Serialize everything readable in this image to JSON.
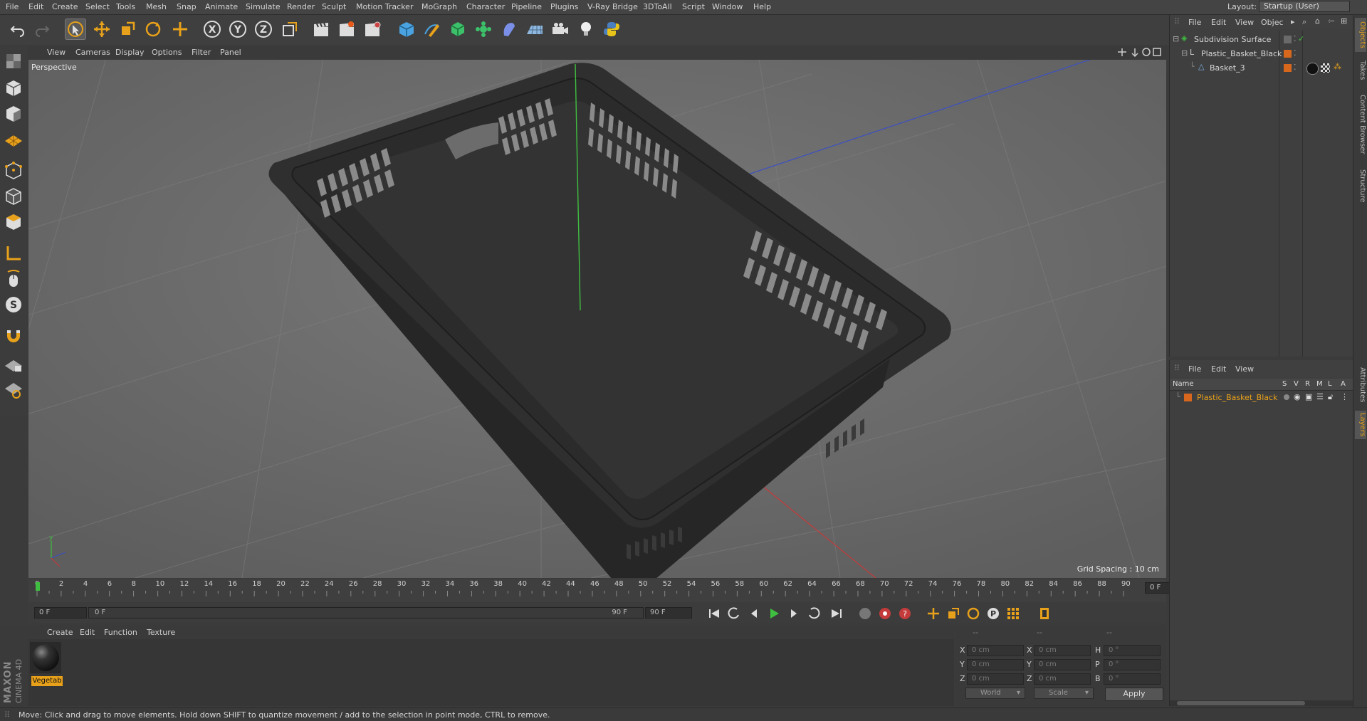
{
  "menubar": {
    "items": [
      "File",
      "Edit",
      "Create",
      "Select",
      "Tools",
      "Mesh",
      "Snap",
      "Animate",
      "Simulate",
      "Render",
      "Sculpt",
      "Motion Tracker",
      "MoGraph",
      "Character",
      "Pipeline",
      "Plugins",
      "V-Ray Bridge",
      "3DToAll",
      "Script",
      "Window",
      "Help"
    ],
    "layout_label": "Layout:",
    "layout_value": "Startup (User)"
  },
  "viewport": {
    "menu": [
      "View",
      "Cameras",
      "Display",
      "Options",
      "Filter",
      "Panel"
    ],
    "camera_label": "Perspective",
    "grid_spacing": "Grid Spacing : 10 cm"
  },
  "timeline": {
    "ticks": [
      "0",
      "2",
      "4",
      "6",
      "8",
      "10",
      "12",
      "14",
      "16",
      "18",
      "20",
      "22",
      "24",
      "26",
      "28",
      "30",
      "32",
      "34",
      "36",
      "38",
      "40",
      "42",
      "44",
      "46",
      "48",
      "50",
      "52",
      "54",
      "56",
      "58",
      "60",
      "62",
      "64",
      "66",
      "68",
      "70",
      "72",
      "74",
      "76",
      "78",
      "80",
      "82",
      "84",
      "86",
      "88",
      "90"
    ],
    "current_frame": "0 F",
    "start_field": "0 F",
    "range_start": "0 F",
    "range_end": "90 F",
    "end_field": "90 F"
  },
  "material_manager": {
    "menu": [
      "Create",
      "Edit",
      "Function",
      "Texture"
    ],
    "materials": [
      {
        "name": "Vegetab"
      }
    ]
  },
  "coordinates": {
    "header": [
      "--",
      "--",
      "--"
    ],
    "rows": [
      {
        "l1": "X",
        "v1": "0 cm",
        "l2": "X",
        "v2": "0 cm",
        "l3": "H",
        "v3": "0 °"
      },
      {
        "l1": "Y",
        "v1": "0 cm",
        "l2": "Y",
        "v2": "0 cm",
        "l3": "P",
        "v3": "0 °"
      },
      {
        "l1": "Z",
        "v1": "0 cm",
        "l2": "Z",
        "v2": "0 cm",
        "l3": "B",
        "v3": "0 °"
      }
    ],
    "space_select": "World",
    "mode_select": "Scale",
    "apply_label": "Apply"
  },
  "object_manager": {
    "menu": [
      "File",
      "Edit",
      "View",
      "Objec"
    ],
    "objects": [
      {
        "name": "Subdivision Surface",
        "indent": 0
      },
      {
        "name": "Plastic_Basket_Black",
        "indent": 1
      },
      {
        "name": "Basket_3",
        "indent": 2
      }
    ]
  },
  "layer_manager": {
    "menu": [
      "File",
      "Edit",
      "View"
    ],
    "columns": [
      "Name",
      "S",
      "V",
      "R",
      "M",
      "L",
      "A"
    ],
    "layers": [
      {
        "name": "Plastic_Basket_Black",
        "color": "#d8671e"
      }
    ]
  },
  "side_tabs": [
    "Objects",
    "Takes",
    "Content Browser",
    "Structure",
    "Attributes",
    "Layers"
  ],
  "status": {
    "text": "Move: Click and drag to move elements. Hold down SHIFT to quantize movement / add to the selection in point mode, CTRL to remove."
  },
  "logo": {
    "line1": "MAXON",
    "line2": "CINEMA 4D"
  },
  "colors": {
    "accent": "#e8a11a",
    "x_axis": "#c43b3b",
    "y_axis": "#3fbf3f",
    "z_axis": "#3b4fc4",
    "layer": "#d8671e"
  }
}
